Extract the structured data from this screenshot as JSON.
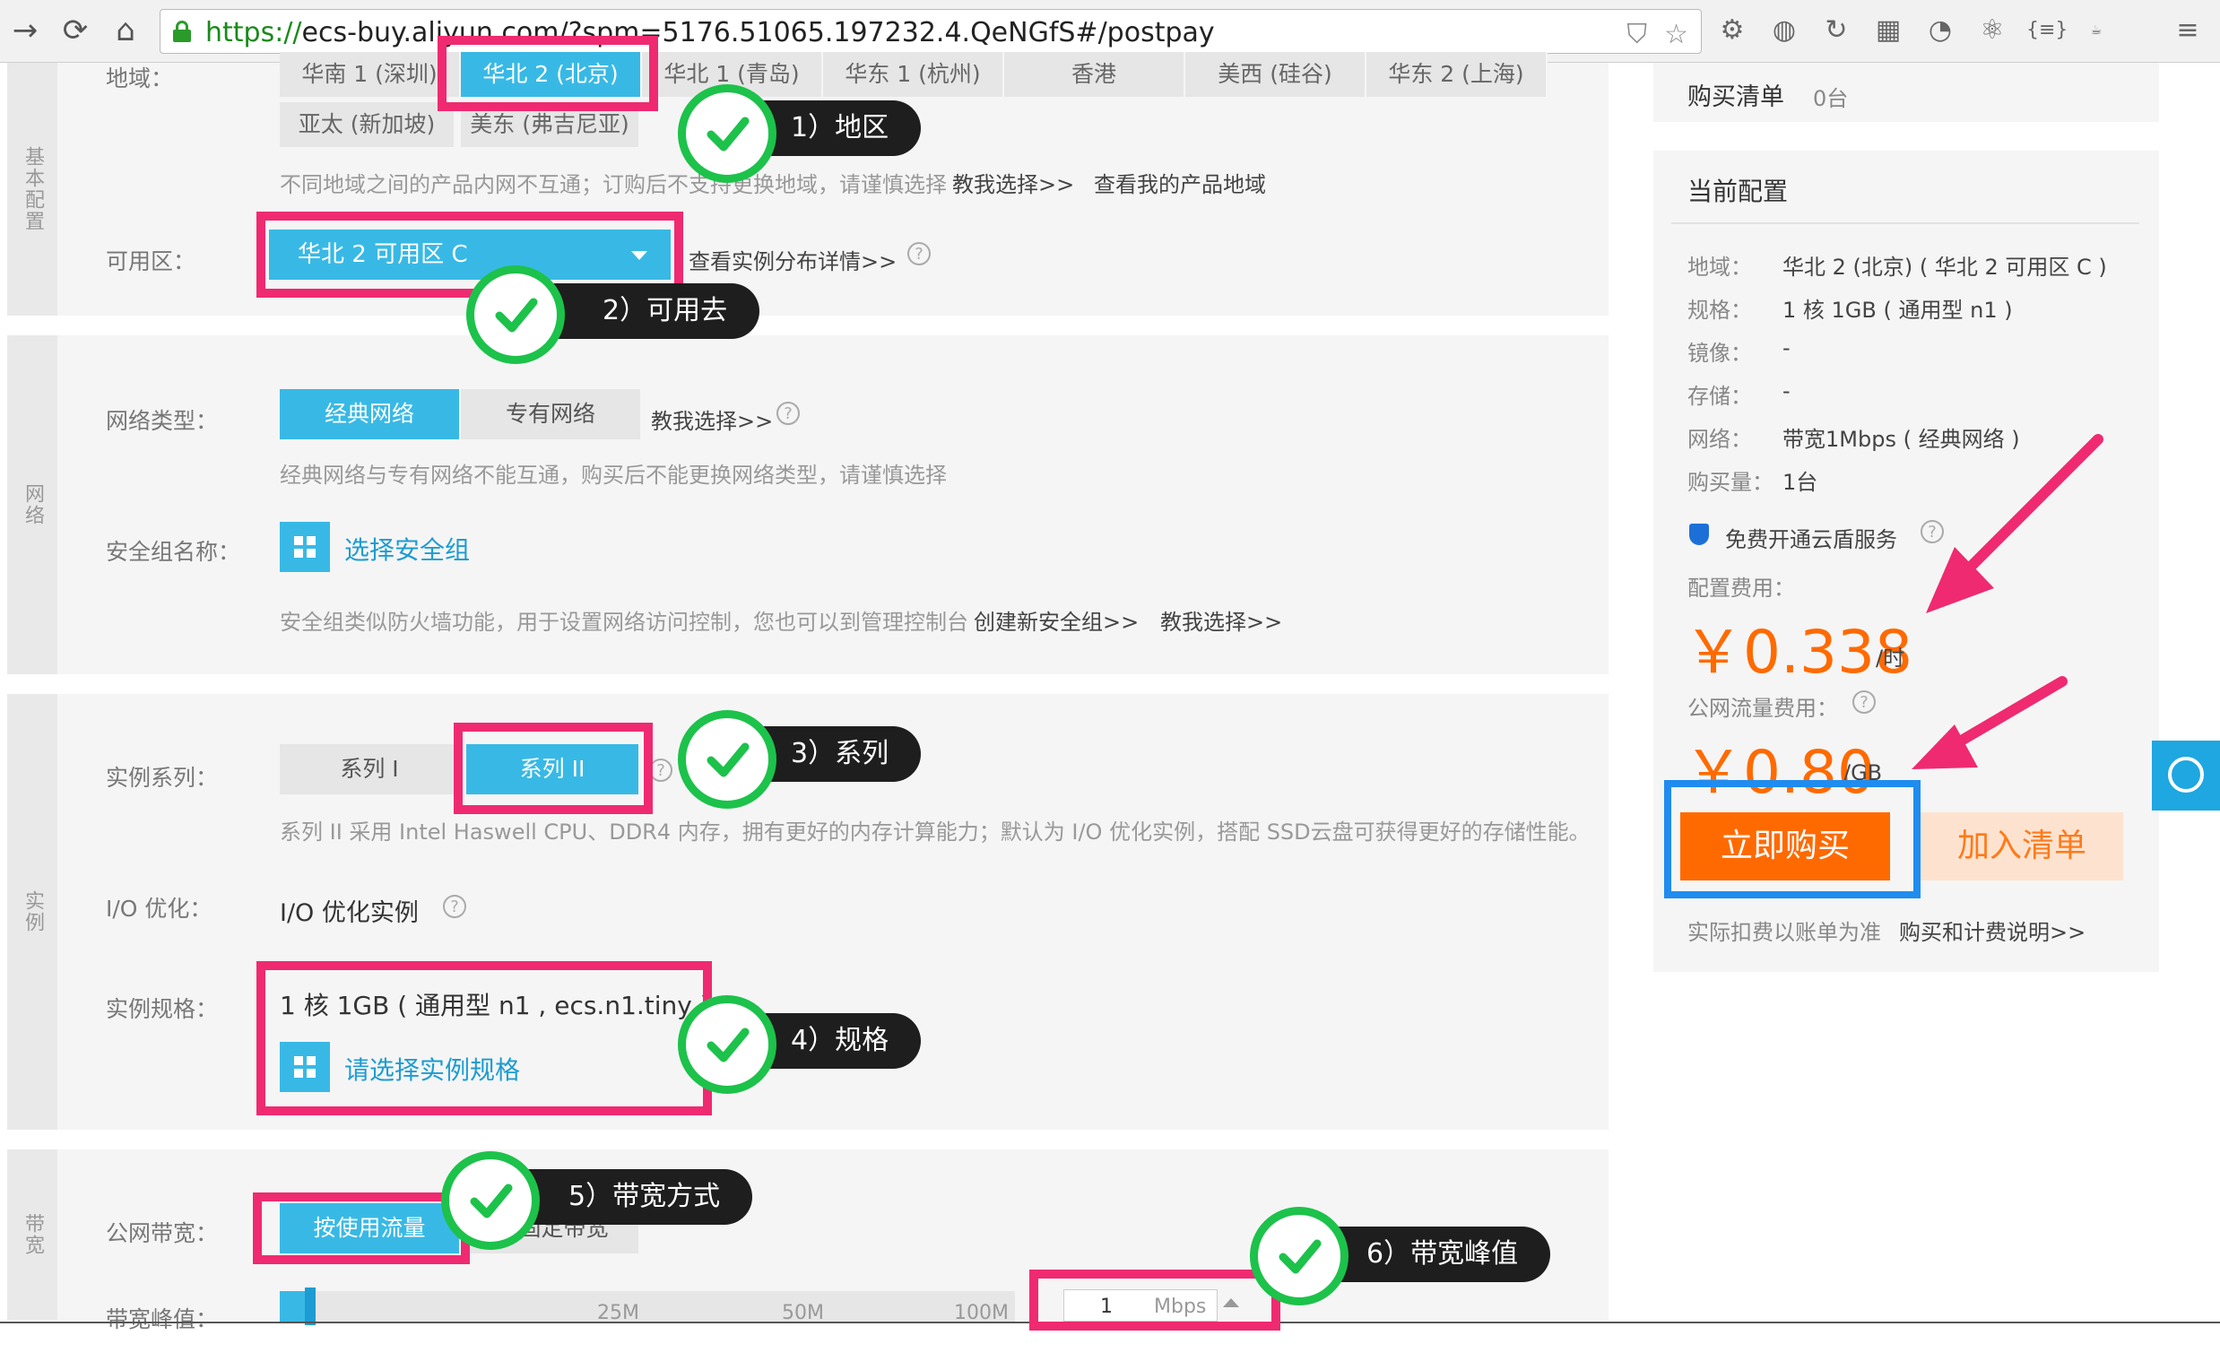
{
  "browser": {
    "url_prefix": "https://",
    "url_rest": "ecs-buy.aliyun.com/?spm=5176.51065.197232.4.QeNGfS#/postpay"
  },
  "basic": {
    "tab_label": "基本配置",
    "region_label": "地域：",
    "regions_row1": [
      "华南 1 (深圳)",
      "华北 2 (北京)",
      "华北 1 (青岛)",
      "华东 1 (杭州)",
      "香港",
      "美西 (硅谷)",
      "华东 2 (上海)"
    ],
    "regions_row2": [
      "亚太 (新加坡)",
      "美东 (弗吉尼亚)"
    ],
    "region_hint": "不同地域之间的产品内网不互通；订购后不支持更换地域，请谨慎选择",
    "help_select": "教我选择>>",
    "my_regions": "查看我的产品地域",
    "zone_label": "可用区：",
    "zone_value": "华北 2 可用区 C",
    "zone_link": "查看实例分布详情>>"
  },
  "network": {
    "tab_label": "网络",
    "type_label": "网络类型：",
    "type_options": [
      "经典网络",
      "专有网络"
    ],
    "help_select": "教我选择>>",
    "type_hint": "经典网络与专有网络不能互通，购买后不能更换网络类型，请谨慎选择",
    "sg_label": "安全组名称：",
    "sg_select": "选择安全组",
    "sg_hint": "安全组类似防火墙功能，用于设置网络访问控制，您也可以到管理控制台",
    "sg_create": "创建新安全组>>",
    "sg_help": "教我选择>>"
  },
  "instance": {
    "tab_label": "实例",
    "series_label": "实例系列：",
    "series_options": [
      "系列 I",
      "系列 II"
    ],
    "series_hint": "系列 II 采用 Intel Haswell CPU、DDR4 内存，拥有更好的内存计算能力；默认为 I/O 优化实例，搭配 SSD云盘可获得更好的存储性能。",
    "io_label": "I/O 优化：",
    "io_value": "I/O 优化实例",
    "spec_label": "实例规格：",
    "spec_value": "1 核 1GB ( 通用型 n1 , ecs.n1.tiny )",
    "spec_select": "请选择实例规格"
  },
  "bandwidth": {
    "tab_label": "带宽",
    "public_label": "公网带宽：",
    "options": [
      "按使用流量",
      "按固定带宽"
    ],
    "peak_label": "带宽峰值：",
    "ticks": [
      "25M",
      "50M",
      "100M"
    ],
    "input_value": "1",
    "input_unit": "Mbps"
  },
  "sidebar": {
    "cart_label": "购买清单",
    "cart_count": "0台",
    "current_title": "当前配置",
    "rows": [
      {
        "label": "地域：",
        "value": "华北 2 (北京) ( 华北 2 可用区 C )"
      },
      {
        "label": "规格：",
        "value": "1 核 1GB ( 通用型 n1 )"
      },
      {
        "label": "镜像：",
        "value": "-"
      },
      {
        "label": "存储：",
        "value": "-"
      },
      {
        "label": "网络：",
        "value": "带宽1Mbps ( 经典网络 )"
      },
      {
        "label": "购买量：",
        "value": "1台"
      }
    ],
    "cloudshield": "免费开通云盾服务",
    "config_fee_label": "配置费用：",
    "config_price": "￥0.338",
    "config_unit": "/时",
    "traffic_fee_label": "公网流量费用：",
    "traffic_price": "￥0.80",
    "traffic_unit": "/GB",
    "buy_now": "立即购买",
    "add_cart": "加入清单",
    "footer_note": "实际扣费以账单为准",
    "footer_link": "购买和计费说明>>"
  },
  "annotations": {
    "step1": "1）地区",
    "step2": "2）可用去",
    "step3": "3）系列",
    "step4": "4）规格",
    "step5": "5）带宽方式",
    "step6": "6）带宽峰值"
  },
  "colors": {
    "accent_blue": "#38b9e5",
    "highlight_pink": "#ef2a70",
    "highlight_blue": "#1f8cf0",
    "price_orange": "#ff6a00",
    "check_green": "#1cc24a"
  }
}
